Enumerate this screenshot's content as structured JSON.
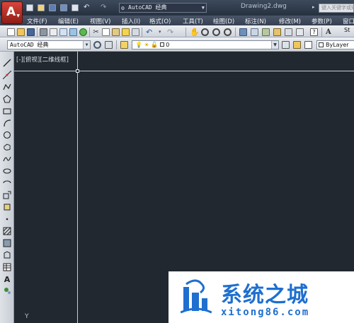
{
  "window": {
    "doc_title": "Drawing2.dwg",
    "workspace": "AutoCAD 经典",
    "search_placeholder": "键入关键字或短语"
  },
  "menu": [
    {
      "label": "文件(F)"
    },
    {
      "label": "编辑(E)"
    },
    {
      "label": "视图(V)"
    },
    {
      "label": "插入(I)"
    },
    {
      "label": "格式(O)"
    },
    {
      "label": "工具(T)"
    },
    {
      "label": "绘图(D)"
    },
    {
      "label": "标注(N)"
    },
    {
      "label": "修改(M)"
    },
    {
      "label": "参数(P)"
    },
    {
      "label": "窗口"
    }
  ],
  "toolbar": {
    "workspace_select": "AutoCAD 经典",
    "layer_value": "0",
    "linetype_value": "ByLayer",
    "style_label": "St"
  },
  "viewport": {
    "label": "[-][俯视][二维线框]",
    "ucs_axis": "Y"
  },
  "watermark": {
    "cn": "系统之城",
    "en": "xitong86.com"
  },
  "colors": {
    "canvas": "#212830",
    "accent_red": "#c9342a",
    "watermark_blue": "#1e6fd0"
  }
}
